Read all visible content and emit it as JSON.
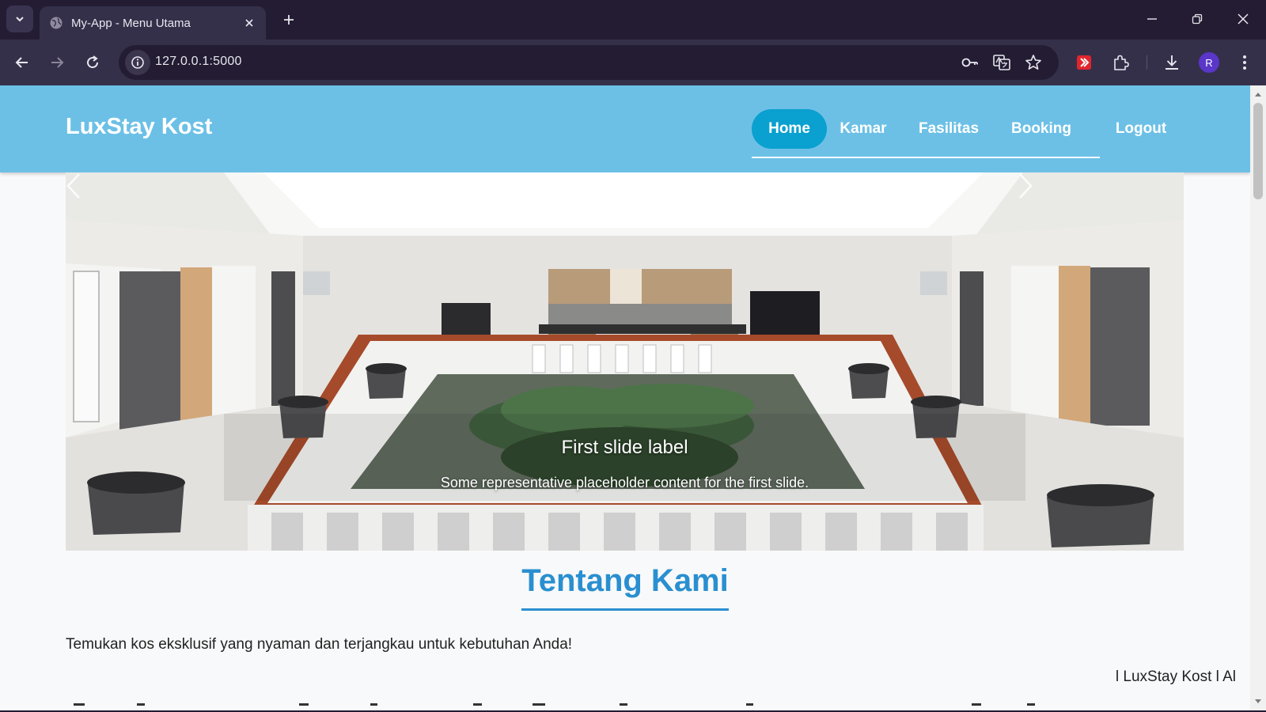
{
  "browser": {
    "tab_title": "My-App - Menu Utama",
    "url": "127.0.0.1:5000",
    "profile_initial": "R"
  },
  "icons": {
    "tab_list": "chevron-down-icon",
    "favicon": "globe-icon",
    "tab_close": "close-icon",
    "new_tab": "plus-icon",
    "back": "arrow-left-icon",
    "forward": "arrow-right-icon",
    "reload": "reload-icon",
    "site_info": "info-icon",
    "password": "key-icon",
    "translate": "translate-icon",
    "bookmark": "star-icon",
    "extension_red": "red-extension-icon",
    "extensions": "puzzle-icon",
    "downloads": "download-icon",
    "menu": "kebab-menu-icon"
  },
  "site": {
    "brand": "LuxStay Kost",
    "nav": {
      "home": "Home",
      "kamar": "Kamar",
      "fasilitas": "Fasilitas",
      "booking": "Booking",
      "logout": "Logout",
      "active": "Home"
    },
    "colors": {
      "navbar": "#6cc0e6",
      "active_pill": "#0aa0cf",
      "heading": "#2a8fd0"
    }
  },
  "carousel": {
    "caption_title": "First slide label",
    "caption_text": "Some representative placeholder content for the first slide.",
    "slide_count": 3,
    "active_index": 0
  },
  "about": {
    "title": "Tentang Kami",
    "intro": "Temukan kos eksklusif yang nyaman dan terjangkau untuk kebutuhan Anda!",
    "marquee": "l LuxStay Kost l Al"
  }
}
